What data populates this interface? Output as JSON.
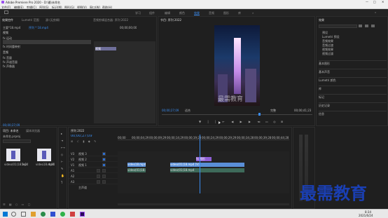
{
  "titlebar": {
    "title": "Adobe Premiere Pro 2020 - D:\\最\\未命名"
  },
  "menu": [
    "文件(F)",
    "编辑(E)",
    "剪辑(C)",
    "序列(S)",
    "标记(M)",
    "图形(G)",
    "视图(V)",
    "窗口(W)",
    "帮助(H)"
  ],
  "workspaces": [
    "学习",
    "组件",
    "编辑",
    "颜色",
    "效果",
    "音频",
    "图形",
    "库"
  ],
  "workspace_active": "效果",
  "effect_controls": {
    "tabs": [
      "效果控件",
      "Lumetri 范围",
      "源:(无剪辑)",
      "音频剪辑混合器: 序列 2022"
    ],
    "source_path": "主要*18.mp4",
    "clip_label": "序列 * 18.mp4",
    "timecode_top": "00;00;00;00",
    "section_video": "视频",
    "rows": [
      "fx 运动",
      "fx 不透明度",
      "fx 时间重映射"
    ],
    "audio_section": "音频",
    "audio_rows": [
      "fx 音量",
      "fx 声道音量",
      "fx 声像器"
    ],
    "bottom_timecode": "00;00;27;09",
    "right_chip": "视频"
  },
  "program": {
    "title": "节目: 序列 2022",
    "watermark": "最需教育",
    "timecode_left": "00;00;27;09",
    "fit": "适合",
    "fraction": "完整",
    "timecode_right": "00;00;41;23"
  },
  "effects_panel": {
    "title": "效果",
    "items": [
      "预设",
      "Lumetri 预设",
      "音频效果",
      "音频过渡",
      "视频效果",
      "视频过渡"
    ],
    "sections": [
      "基本图形",
      "基本声音",
      "Lumetri 颜色",
      "库",
      "标记",
      "历史记录",
      "信息"
    ]
  },
  "project": {
    "tabs": [
      "项目: 未命名",
      "媒体浏览器"
    ],
    "path": "未命名.prproj",
    "items": [
      {
        "label": "video(01)18.mp4",
        "meta": "5s2"
      },
      {
        "label": "video18.mp4",
        "meta": "4:44"
      }
    ]
  },
  "timeline": {
    "title": "序列 2022",
    "timecode": "00;00;27;09",
    "ruler": [
      "00;00",
      "00;00;04;29",
      "00;00;09;29",
      "00;00;14;29",
      "00;00;19;29",
      "00;00;24;29",
      "00;00;29;29",
      "00;00;34;28",
      "00;00;39;28",
      "00;00;44;28"
    ],
    "tracks": [
      "V3",
      "V2",
      "V1",
      "A1",
      "A2",
      "A3"
    ],
    "track_labels": [
      "视频 3",
      "视频 2",
      "视频 1",
      "",
      "",
      "主声道"
    ],
    "clip_v2_label": "fx 图形",
    "clip_a_label": "video(01)18.mp4",
    "clip_v1_label": "video(01)18.mp4 [V]",
    "clip_v1_small": "video18.mp4"
  },
  "taskbar": {
    "time": "8:34",
    "date": "2021/6/24"
  },
  "watermark_large": "最需教育",
  "colors": {
    "accent": "#2e6fd1",
    "clip_purple": "#8f5fd4",
    "clip_blue": "#5a8fd8",
    "playhead": "#3a8cf0",
    "watermark": "#1a3fb3"
  }
}
